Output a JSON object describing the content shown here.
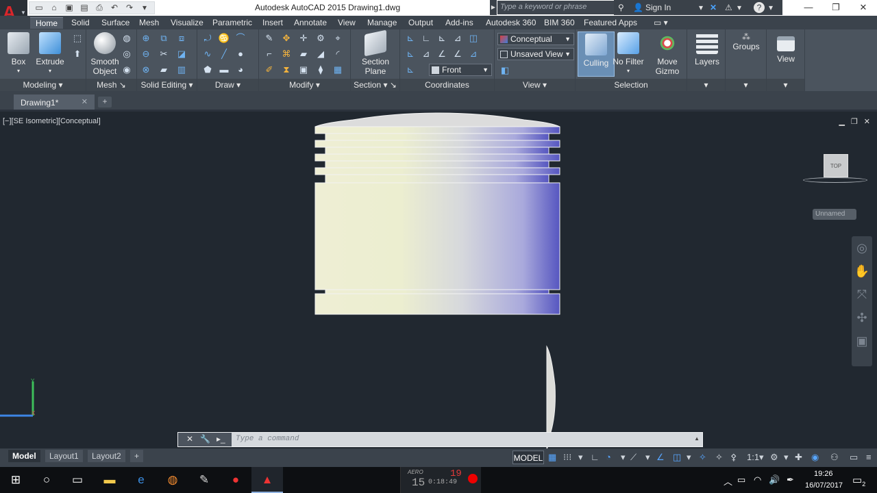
{
  "title_bar": {
    "app_title": "Autodesk AutoCAD 2015   Drawing1.dwg",
    "search_placeholder": "Type a keyword or phrase",
    "sign_in": "Sign In",
    "help": "?"
  },
  "ribbon_tabs": [
    "Home",
    "Solid",
    "Surface",
    "Mesh",
    "Visualize",
    "Parametric",
    "Insert",
    "Annotate",
    "View",
    "Manage",
    "Output",
    "Add-ins",
    "Autodesk 360",
    "BIM 360",
    "Featured Apps"
  ],
  "ribbon": {
    "box_label": "Box",
    "extrude_label": "Extrude",
    "smooth_label_1": "Smooth",
    "smooth_label_2": "Object",
    "section_label_1": "Section",
    "section_label_2": "Plane",
    "visual_style": "Conceptual",
    "saved_view": "Unsaved View",
    "view_direction": "Front",
    "culling_label": "Culling",
    "nofilter_label": "No Filter",
    "movegizmo_label_1": "Move",
    "movegizmo_label_2": "Gizmo",
    "layers_label": "Layers",
    "groups_label": "Groups",
    "view_label": "View",
    "panels": {
      "modeling": "Modeling",
      "mesh": "Mesh",
      "solid_editing": "Solid Editing",
      "draw": "Draw",
      "modify": "Modify",
      "section": "Section",
      "coordinates": "Coordinates",
      "view": "View",
      "selection": "Selection"
    }
  },
  "file_tabs": {
    "doc": "Drawing1*",
    "new": "+"
  },
  "viewport": {
    "label": "[−][SE Isometric][Conceptual]",
    "viewcube_face": "TOP",
    "ucs_name": "Unnamed"
  },
  "command_line": {
    "placeholder": "Type a command"
  },
  "layout_tabs": [
    "Model",
    "Layout1",
    "Layout2"
  ],
  "status_bar": {
    "model": "MODEL",
    "scale": "1:1"
  },
  "recorder": {
    "aero": "AERO",
    "frame": "15",
    "time": "0:18:49",
    "fps": "19"
  },
  "clock": {
    "time": "19:26",
    "date": "16/07/2017"
  },
  "notifications": "2"
}
